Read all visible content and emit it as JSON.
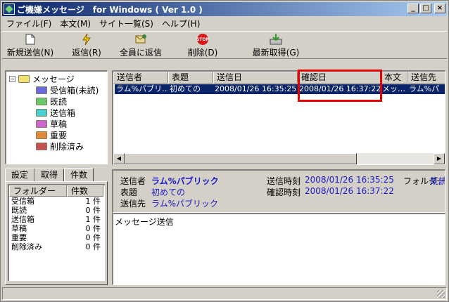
{
  "window": {
    "title": "ご機嫌メッセージ　for Windows ( Ver 1.0 )"
  },
  "menu": [
    "ファイル(F)",
    "本文(M)",
    "サイト一覧(S)",
    "ヘルプ(H)"
  ],
  "toolbar": {
    "new_label": "新規送信(N)",
    "reply_label": "返信(R)",
    "reply_all_label": "全員に返信",
    "delete_label": "削除(D)",
    "refresh_label": "最新取得(G)"
  },
  "tree": {
    "root": "メッセージ",
    "folders": [
      {
        "label": "受信箱(未読)",
        "color": "#6a6ae0"
      },
      {
        "label": "既読",
        "color": "#6ac86a"
      },
      {
        "label": "送信箱",
        "color": "#4ad0d0"
      },
      {
        "label": "草稿",
        "color": "#d064d0"
      },
      {
        "label": "重要",
        "color": "#e08a3a"
      },
      {
        "label": "削除済み",
        "color": "#c85050"
      }
    ]
  },
  "tabs": [
    "設定",
    "取得",
    "件数"
  ],
  "counts": {
    "header_folder": "フォルダー",
    "header_count": "件数",
    "rows": [
      {
        "name": "受信箱",
        "count": "1 件"
      },
      {
        "name": "既読",
        "count": "0 件"
      },
      {
        "name": "送信箱",
        "count": "1 件"
      },
      {
        "name": "草稿",
        "count": "0 件"
      },
      {
        "name": "重要",
        "count": "0 件"
      },
      {
        "name": "削除済み",
        "count": "0 件"
      }
    ]
  },
  "list": {
    "columns": [
      "送信者",
      "表題",
      "送信日",
      "確認日",
      "本文",
      "送信先"
    ],
    "rows": [
      [
        "ラム%パブリ…",
        "初めての",
        "2008/01/26 16:35:25",
        "2008/01/26 16:37:22",
        "メッ…",
        "ラム%パ"
      ]
    ]
  },
  "detail": {
    "sender_label": "送信者",
    "sender": "ラム%パブリック",
    "subject_label": "表題",
    "subject": "初めての",
    "to_label": "送信先",
    "to": "ラム%パブリック",
    "sent_time_label": "送信時刻",
    "sent_time": "2008/01/26 16:35:25",
    "confirm_time_label": "確認時刻",
    "confirm_time": "2008/01/26 16:37:22",
    "folder_label": "フォルダー",
    "folder": "既読"
  },
  "body": {
    "text": "メッセージ送信"
  }
}
